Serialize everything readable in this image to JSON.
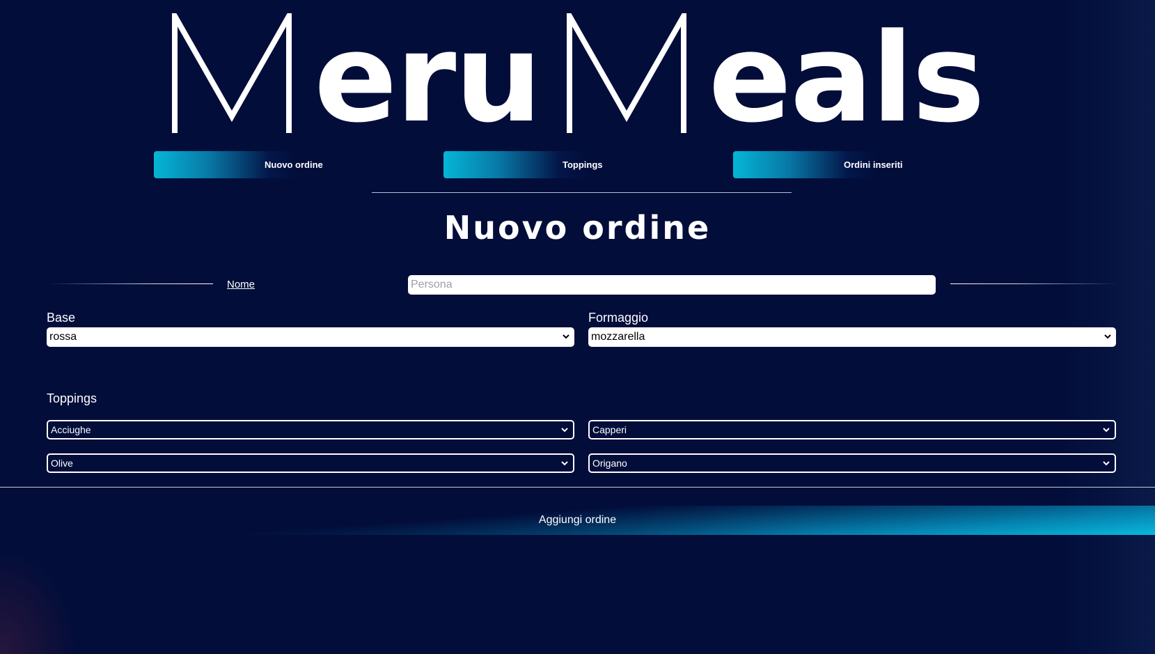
{
  "logo": {
    "part1_rest": "eru",
    "part2_rest": "eals"
  },
  "nav": {
    "items": [
      {
        "label": "Nuovo ordine"
      },
      {
        "label": "Toppings"
      },
      {
        "label": "Ordini inseriti"
      }
    ]
  },
  "page": {
    "title": "Nuovo ordine"
  },
  "form": {
    "nome_label": "Nome",
    "nome_placeholder": "Persona",
    "nome_value": "",
    "base_label": "Base",
    "base_value": "rossa",
    "formaggio_label": "Formaggio",
    "formaggio_value": "mozzarella",
    "toppings_label": "Toppings",
    "toppings": [
      "Acciughe",
      "Capperi",
      "Olive",
      "Origano"
    ],
    "submit_label": "Aggiungi ordine"
  },
  "colors": {
    "background": "#020d3a",
    "accent": "#08b8dd",
    "text": "#ffffff"
  }
}
